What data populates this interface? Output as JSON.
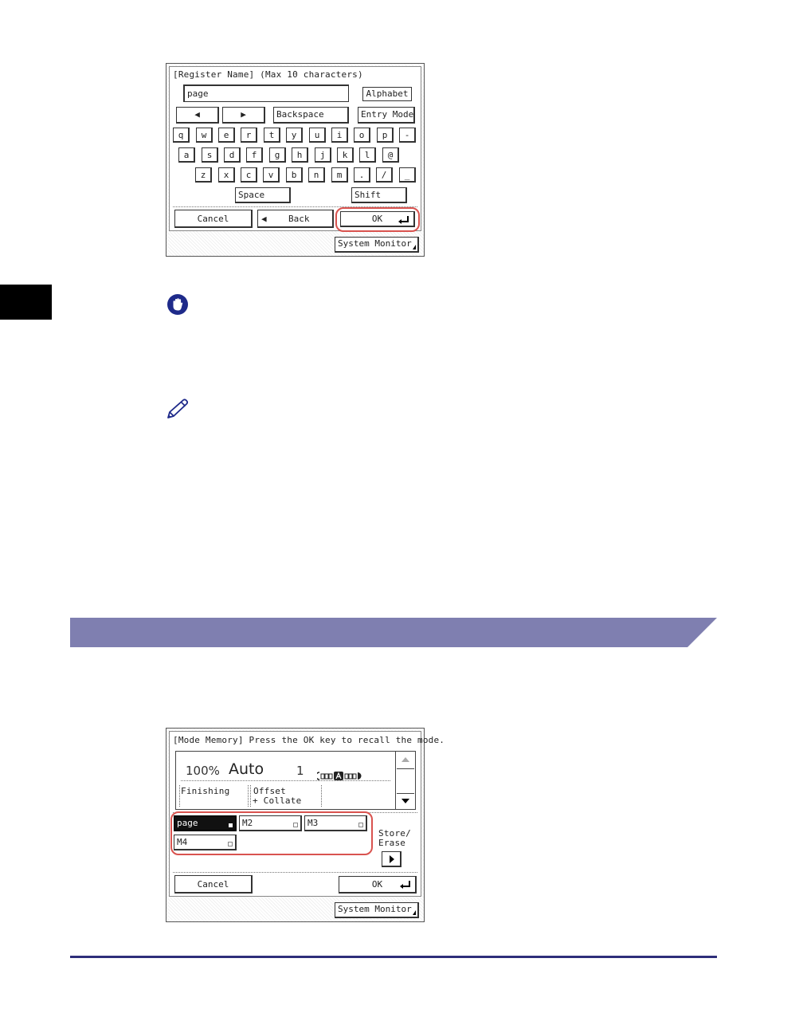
{
  "colors": {
    "accent_red": "#d9534f",
    "section_band": "#7f7fb0",
    "footer_rule": "#2e2e7a",
    "icon_navy": "#1e2a8a"
  },
  "register_panel": {
    "title": "[Register Name] (Max 10 characters)",
    "input_value": "page",
    "alphabet_label": "Alphabet",
    "left_arrow": "◀",
    "right_arrow": "▶",
    "backspace_label": "Backspace",
    "entry_mode_label": "Entry Mode",
    "keys_row1": [
      "q",
      "w",
      "e",
      "r",
      "t",
      "y",
      "u",
      "i",
      "o",
      "p",
      "-"
    ],
    "keys_row2": [
      "a",
      "s",
      "d",
      "f",
      "g",
      "h",
      "j",
      "k",
      "l",
      "@"
    ],
    "keys_row3": [
      "z",
      "x",
      "c",
      "v",
      "b",
      "n",
      "m",
      ".",
      "/",
      "_"
    ],
    "space_label": "Space",
    "shift_label": "Shift",
    "cancel_label": "Cancel",
    "back_label": "Back",
    "back_arrow": "◀",
    "ok_label": "OK",
    "system_monitor_label": "System Monitor"
  },
  "memory_panel": {
    "title": "[Mode Memory] Press the OK key to recall the mode.",
    "zoom": "100%",
    "paper": "Auto",
    "copies": "1",
    "finishing_label": "Finishing",
    "finishing_value_1": "Offset",
    "finishing_value_2": "+ Collate",
    "memory_keys": [
      "page",
      "M2",
      "M3",
      "M4"
    ],
    "store_erase_label_1": "Store/",
    "store_erase_label_2": "Erase",
    "cancel_label": "Cancel",
    "ok_label": "OK",
    "system_monitor_label": "System Monitor"
  }
}
